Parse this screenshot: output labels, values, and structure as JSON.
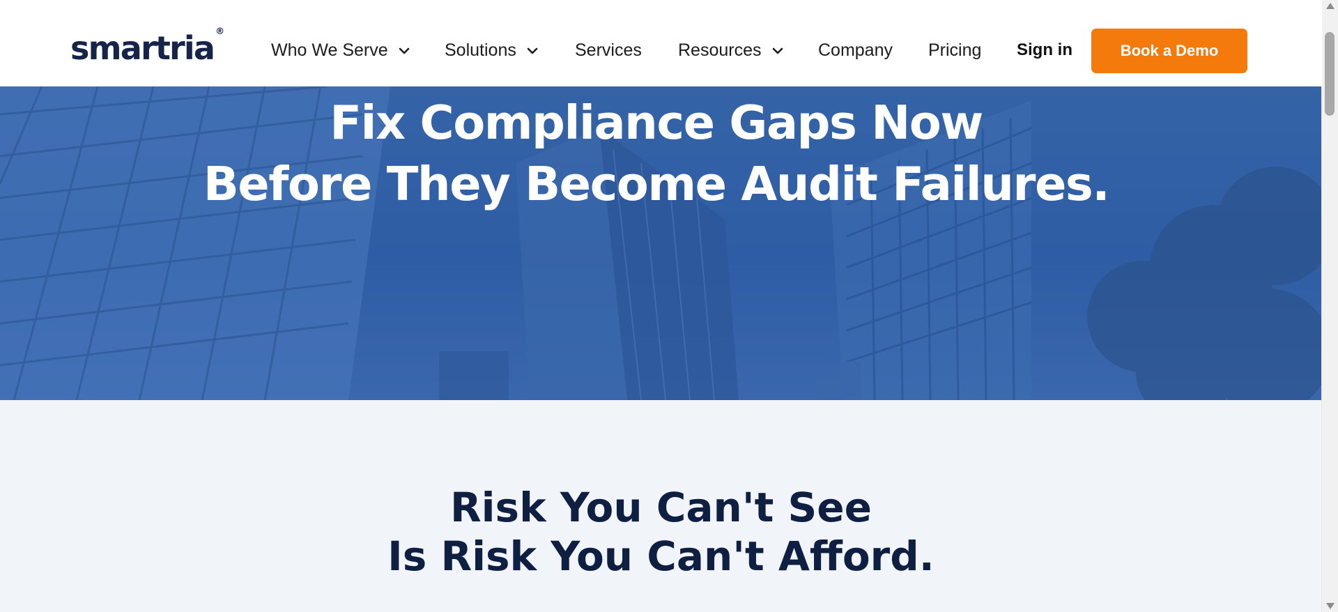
{
  "brand": {
    "name": "smartria",
    "mark": "®"
  },
  "nav": [
    {
      "label": "Who We Serve",
      "dropdown": true,
      "icon": "chevron-down-icon"
    },
    {
      "label": "Solutions",
      "dropdown": true,
      "icon": "chevron-down-icon"
    },
    {
      "label": "Services",
      "dropdown": false
    },
    {
      "label": "Resources",
      "dropdown": true,
      "icon": "chevron-down-icon"
    },
    {
      "label": "Company",
      "dropdown": false
    },
    {
      "label": "Pricing",
      "dropdown": false
    }
  ],
  "auth": {
    "sign_in": "Sign in",
    "cta": "Book a Demo"
  },
  "hero": {
    "line1": "Fix Compliance Gaps Now",
    "line2": "Before They Become Audit Failures."
  },
  "section": {
    "line1": "Risk You Can't See",
    "line2": "Is Risk You Can't Afford."
  },
  "colors": {
    "accent": "#f47b0b",
    "brand_navy": "#16244a",
    "hero_blue": "#2f5da5",
    "page_bg": "#f1f4f9"
  }
}
